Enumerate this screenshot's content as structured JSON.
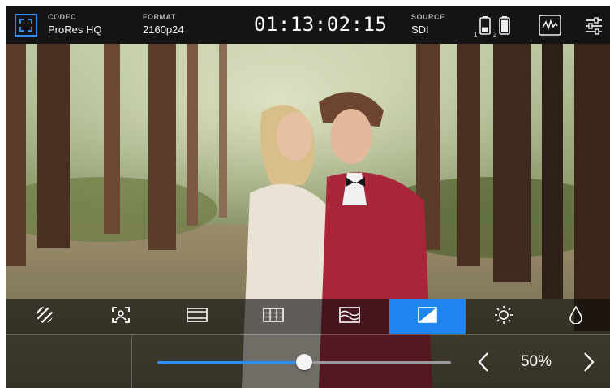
{
  "top_bar": {
    "codec": {
      "label": "CODEC",
      "value": "ProRes HQ"
    },
    "format": {
      "label": "FORMAT",
      "value": "2160p24"
    },
    "timecode": "01:13:02:15",
    "source": {
      "label": "SOURCE",
      "value": "SDI"
    },
    "batteries": [
      {
        "slot": "1",
        "level": 0.4
      },
      {
        "slot": "2",
        "level": 0.95
      }
    ],
    "icons": [
      "full-screen-icon",
      "waveform-icon",
      "settings-sliders-icon"
    ]
  },
  "toolbar": {
    "tools": [
      {
        "icon": "zebra-icon"
      },
      {
        "icon": "focus-assist-icon"
      },
      {
        "icon": "frame-guides-icon"
      },
      {
        "icon": "grid-icon"
      },
      {
        "icon": "false-color-icon"
      },
      {
        "icon": "contrast-icon",
        "active": true
      },
      {
        "icon": "brightness-icon"
      },
      {
        "icon": "saturation-icon"
      }
    ]
  },
  "slider": {
    "value_label": "50%",
    "value": 0.5,
    "prev_icon": "chevron-left-icon",
    "next_icon": "chevron-right-icon"
  },
  "colors": {
    "accent": "#1f86f0",
    "bar": "#141414",
    "slider_fill": "#2f8df2"
  }
}
